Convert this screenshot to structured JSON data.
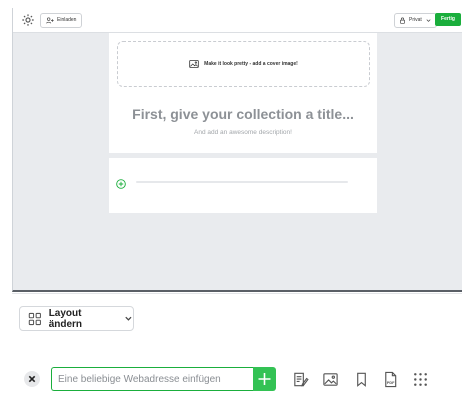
{
  "toolbar": {
    "invite_label": "Einladen",
    "privacy_value": "Privat",
    "done_label": "Fertig"
  },
  "cover": {
    "prompt": "Make it look pretty - add a cover image!"
  },
  "collection": {
    "title_placeholder": "First, give your collection a title...",
    "description_placeholder": "And add an awesome description!"
  },
  "bottom": {
    "layout_button_label": "Layout ändern",
    "url_input_placeholder": "Eine beliebige Webadresse einfügen"
  },
  "colors": {
    "accent_green": "#1aae3c",
    "add_green": "#33c254",
    "canvas_gray": "#e9ebee"
  },
  "icons": {
    "settings": "gear-icon",
    "invite": "add-person-icon",
    "privacy": "lock-icon",
    "cover": "image-icon",
    "add_block": "plus-circle-icon",
    "layout": "grid-icon",
    "close": "close-icon",
    "add_url": "plus-icon",
    "text": "text-note-icon",
    "image": "image-icon",
    "bookmark": "bookmark-icon",
    "pdf": "pdf-file-icon",
    "more": "apps-grid-icon"
  }
}
